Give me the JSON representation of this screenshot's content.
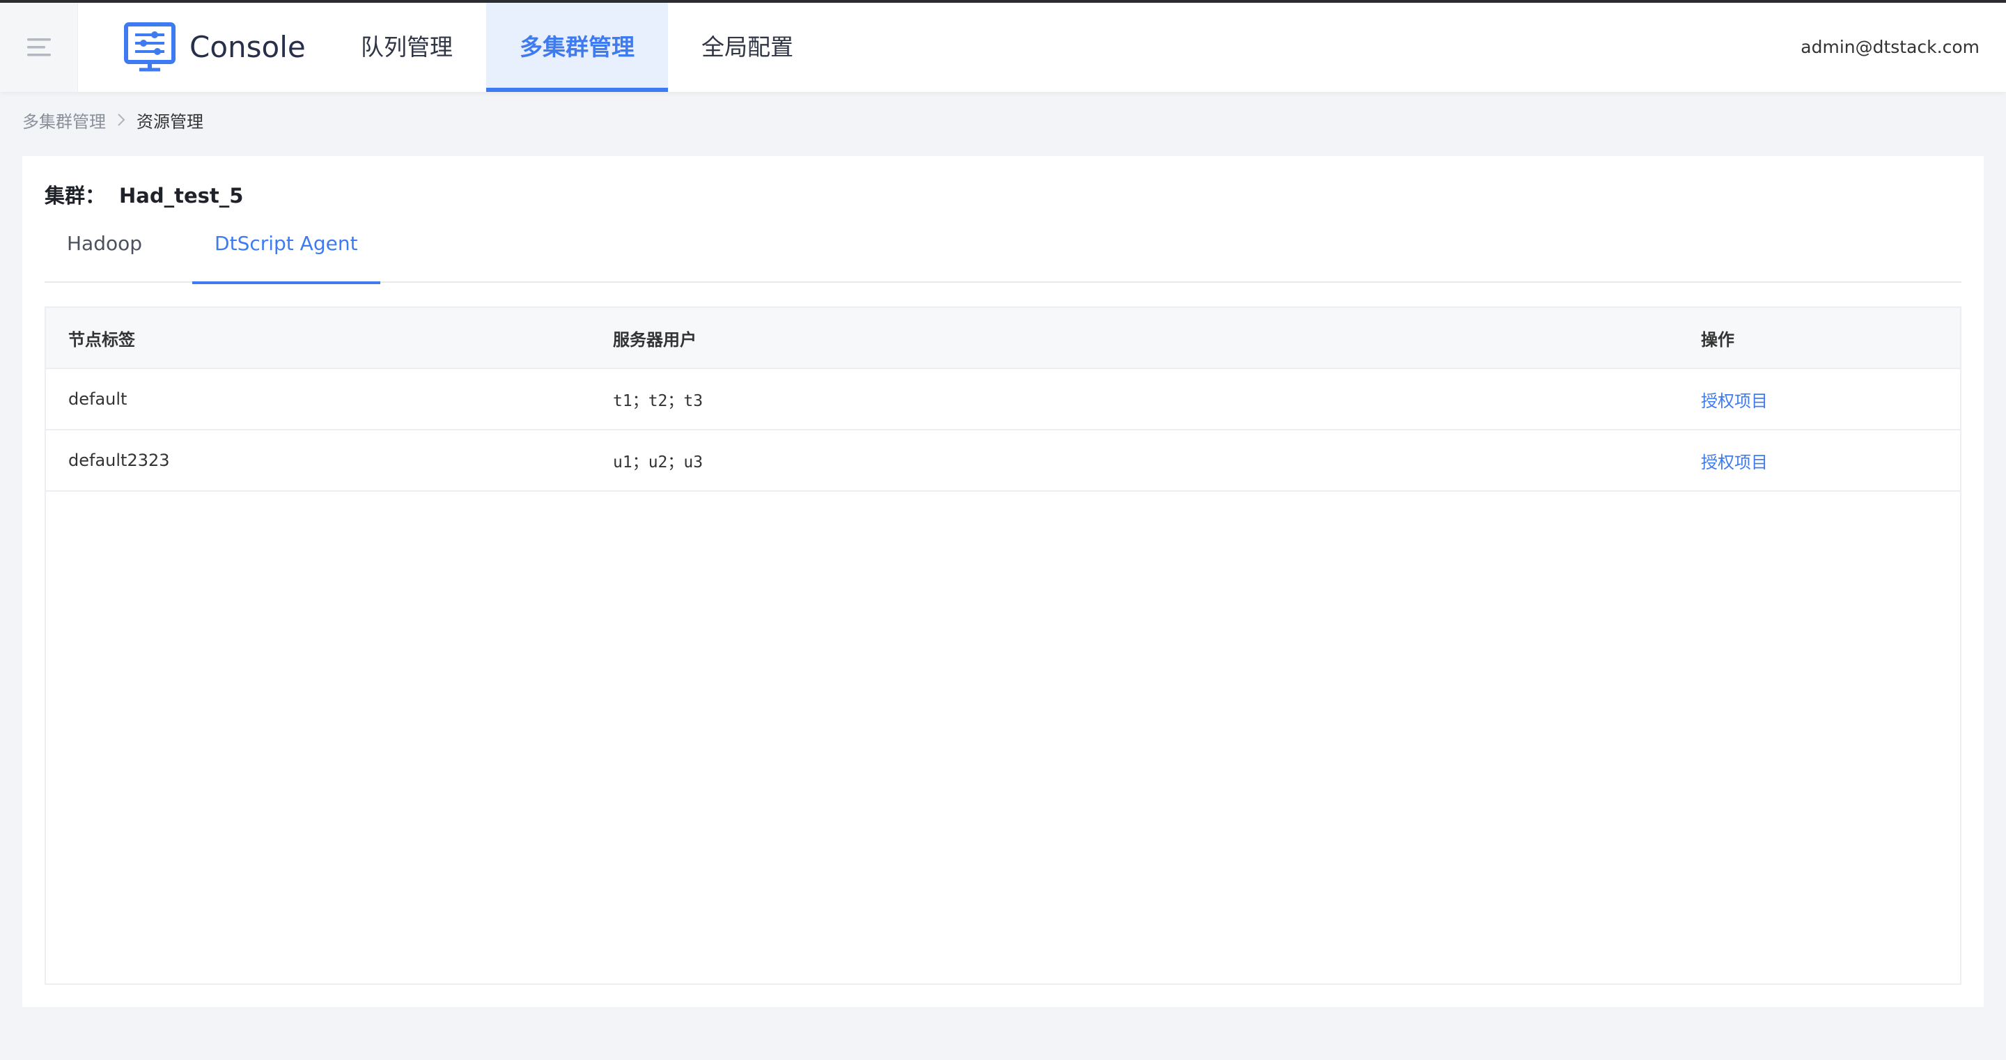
{
  "header": {
    "brand": "Console",
    "nav": [
      {
        "label": "队列管理",
        "active": false
      },
      {
        "label": "多集群管理",
        "active": true
      },
      {
        "label": "全局配置",
        "active": false
      }
    ],
    "user": "admin@dtstack.com",
    "accent_color": "#3f7bf0"
  },
  "breadcrumb": {
    "parent": "多集群管理",
    "current": "资源管理"
  },
  "cluster": {
    "label": "集群：",
    "name": "Had_test_5"
  },
  "tabs": [
    {
      "label": "Hadoop",
      "active": false
    },
    {
      "label": "DtScript Agent",
      "active": true
    }
  ],
  "table": {
    "columns": [
      "节点标签",
      "服务器用户",
      "操作"
    ],
    "rows": [
      {
        "node_label": "default",
        "server_users": "t1；t2；t3",
        "action": "授权项目"
      },
      {
        "node_label": "default2323",
        "server_users": "u1；u2；u3",
        "action": "授权项目"
      }
    ]
  },
  "icons": {
    "menu": "menu-icon",
    "logo": "console-logo-icon",
    "breadcrumb_separator": "chevron-right-icon"
  }
}
